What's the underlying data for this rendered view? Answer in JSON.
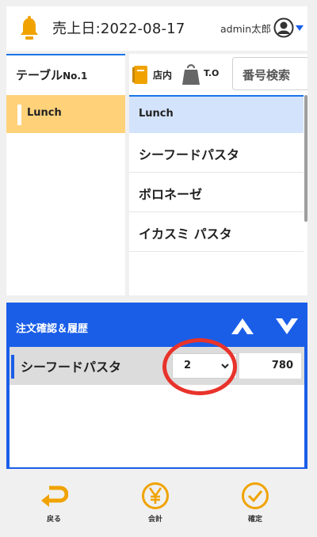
{
  "header": {
    "sales_date": "売上日:2022-08-17",
    "admin_name": "admin太郎"
  },
  "left_panel": {
    "table_no_prefix": "テーブル",
    "table_no_num": "No.1",
    "category": "Lunch"
  },
  "right_panel": {
    "tab_eat_in": "店内",
    "tab_takeout": "T.O",
    "number_search": "番号検索",
    "category": "Lunch",
    "items": [
      "シーフードパスタ",
      "ボロネーゼ",
      "イカスミ パスタ"
    ]
  },
  "order": {
    "title": "注文確認＆履歴",
    "rows": [
      {
        "name": "シーフードパスタ",
        "qty": "2",
        "price": "780"
      }
    ]
  },
  "footer": {
    "back_label": "戻る",
    "checkout_label": "会計",
    "confirm_label": "確定"
  },
  "colors": {
    "accent_blue": "#1a5ee8",
    "category_yellow": "#ffd27a",
    "icon_orange": "#f0a300",
    "highlight_red": "#e8332b"
  },
  "icons": [
    "bell-icon",
    "user-icon",
    "caret-down-icon",
    "eat-in-icon",
    "takeout-icon",
    "arrow-up-icon",
    "arrow-down-icon",
    "chevron-down-icon",
    "return-icon",
    "yen-icon",
    "check-icon"
  ]
}
